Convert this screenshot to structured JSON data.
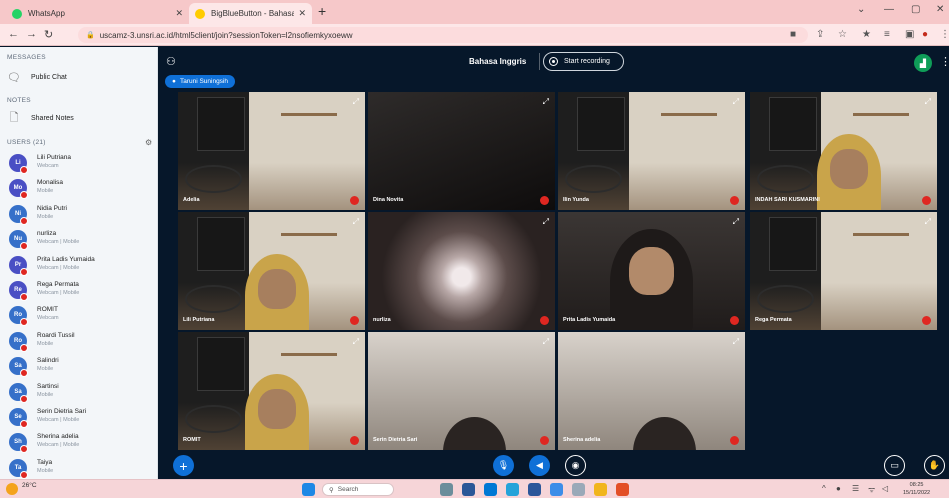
{
  "browser": {
    "tabs": [
      {
        "title": "WhatsApp",
        "icon": "whatsapp-icon",
        "color": "#25d366"
      },
      {
        "title": "BigBlueButton - Bahasa Ingg",
        "icon": "bigbluebutton-icon",
        "color": "#ffcc00"
      }
    ],
    "url": "uscamz-3.unsri.ac.id/html5client/join?sessionToken=l2nsofiemkyxoeww"
  },
  "sidebar": {
    "messages_title": "MESSAGES",
    "public_chat": "Public Chat",
    "notes_title": "NOTES",
    "shared_notes": "Shared Notes",
    "users_title": "USERS (21)",
    "users": [
      {
        "initials": "Li",
        "name": "Lili Putriana",
        "status": "Webcam",
        "color": "#4a4fc4"
      },
      {
        "initials": "Mo",
        "name": "Monalisa",
        "status": "Mobile",
        "color": "#4a4fc4"
      },
      {
        "initials": "Ni",
        "name": "Nidia Putri",
        "status": "Mobile",
        "color": "#3670c9"
      },
      {
        "initials": "Nu",
        "name": "nurliza",
        "status": "Webcam | Mobile",
        "color": "#3670c9"
      },
      {
        "initials": "Pr",
        "name": "Prita Ladis Yumaida",
        "status": "Webcam | Mobile",
        "color": "#4a4fc4"
      },
      {
        "initials": "Re",
        "name": "Rega Permata",
        "status": "Webcam | Mobile",
        "color": "#4a4fc4"
      },
      {
        "initials": "Ro",
        "name": "ROMIT",
        "status": "Webcam",
        "color": "#3670c9"
      },
      {
        "initials": "Ro",
        "name": "Roardi Tussil",
        "status": "Mobile",
        "color": "#3670c9"
      },
      {
        "initials": "Sa",
        "name": "Salindri",
        "status": "Mobile",
        "color": "#3670c9"
      },
      {
        "initials": "Sa",
        "name": "Sartinsi",
        "status": "Mobile",
        "color": "#3670c9"
      },
      {
        "initials": "Se",
        "name": "Serin Dietria Sari",
        "status": "Webcam | Mobile",
        "color": "#3670c9"
      },
      {
        "initials": "Sh",
        "name": "Sherina adelia",
        "status": "Webcam | Mobile",
        "color": "#3670c9"
      },
      {
        "initials": "Ta",
        "name": "Taiya",
        "status": "Mobile",
        "color": "#3670c9"
      }
    ]
  },
  "meeting": {
    "presenter": "Taruni Suningsih",
    "session_title": "Bahasa Inggris",
    "record_label": "Start recording",
    "tiles": [
      {
        "name": "Adelia",
        "style": "cafe"
      },
      {
        "name": "Dina Novita",
        "style": "dark"
      },
      {
        "name": "Ilin Yunda",
        "style": "cafe"
      },
      {
        "name": "INDAH SARI KUSMARINI",
        "style": "cafe-face"
      },
      {
        "name": "Lili Putriana",
        "style": "cafe-face"
      },
      {
        "name": "nurliza",
        "style": "blur"
      },
      {
        "name": "Prita Ladis Yumaida",
        "style": "face"
      },
      {
        "name": "Rega Permata",
        "style": "cafe"
      },
      {
        "name": "ROMIT",
        "style": "cafe-face"
      },
      {
        "name": "Serin Dietria Sari",
        "style": "face-low"
      },
      {
        "name": "Sherina adelia",
        "style": "face-low"
      }
    ]
  },
  "taskbar": {
    "temperature": "26°C",
    "search_label": "Search",
    "time": "08:25",
    "date": "15/11/2022"
  },
  "colors": {
    "accent": "#0f70d7",
    "danger": "#df2721",
    "meeting_bg": "#06172a"
  }
}
